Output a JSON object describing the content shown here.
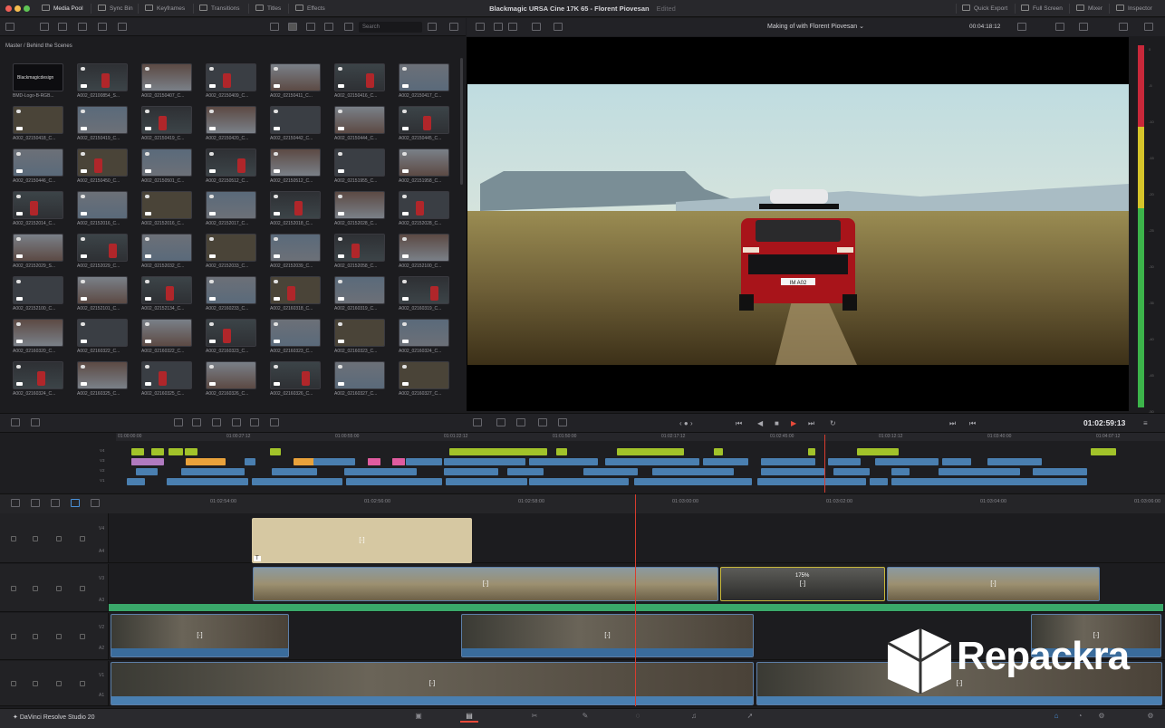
{
  "topbar": {
    "tabs": [
      "Media Pool",
      "Sync Bin",
      "Keyframes",
      "Transitions",
      "Titles",
      "Effects"
    ],
    "title": "Blackmagic URSA Cine 17K 65 - Florent Piovesan",
    "edited": "Edited",
    "right": [
      "Quick Export",
      "Full Screen",
      "Mixer",
      "Inspector"
    ]
  },
  "mediapool": {
    "search_placeholder": "Search",
    "bin_path": "Master / Behind the Scenes",
    "logo_caption": "Blackmagicdesign",
    "clips": [
      "BMD-Logo-B-RGB...",
      "A002_02100854_S...",
      "A002_02150407_C...",
      "A002_02150409_C...",
      "A002_02150411_C...",
      "A002_02150416_C...",
      "A002_02150417_C...",
      "A002_02150418_C...",
      "A002_02150419_C...",
      "A002_02150419_C...",
      "A002_02150420_C...",
      "A002_02150442_C...",
      "A002_02150444_C...",
      "A002_02150445_C...",
      "A002_02150446_C...",
      "A002_02150450_C...",
      "A002_02150501_C...",
      "A002_02150512_C...",
      "A002_02150512_C...",
      "A002_02151955_C...",
      "A002_02151958_C...",
      "A002_02152014_C...",
      "A002_02152016_C...",
      "A002_02152016_C...",
      "A002_02152017_C...",
      "A002_02152018_C...",
      "A002_02152028_C...",
      "A002_02152028_C...",
      "A002_02152029_S...",
      "A002_02152029_C...",
      "A002_02152032_C...",
      "A002_02152033_C...",
      "A002_02152039_C...",
      "A002_02152058_C...",
      "A002_02152100_C...",
      "A002_02152100_C...",
      "A002_02152101_C...",
      "A002_02152134_C...",
      "A002_02160233_C...",
      "A002_02160318_C...",
      "A002_02160319_C...",
      "A002_02160319_C...",
      "A002_02160320_C...",
      "A002_02160322_C...",
      "A002_02160322_C...",
      "A002_02160323_C...",
      "A002_02160323_C...",
      "A002_02160323_C...",
      "A002_02160324_C...",
      "A002_02160324_C...",
      "A002_02160325_C...",
      "A002_02160325_C...",
      "A002_02160326_C...",
      "A002_02160326_C...",
      "A002_02160327_C...",
      "A002_02160327_C..."
    ]
  },
  "viewer": {
    "title": "Making of with Florent Piovesan",
    "timecode_top": "00:04:18:12",
    "timecode": "01:02:59:13",
    "plate": "IM A02"
  },
  "meter_labels": [
    "0",
    "-5",
    "-10",
    "-15",
    "-20",
    "-25",
    "-30",
    "-35",
    "-40",
    "-45",
    "-50"
  ],
  "mini_ruler": [
    "01:00:00:00",
    "01:00:27:12",
    "01:00:55:00",
    "01:01:22:12",
    "01:01:50:00",
    "01:02:17:12",
    "01:02:45:00",
    "01:03:12:12",
    "01:03:40:00",
    "01:04:07:12"
  ],
  "main_ruler": [
    "01:02:54:00",
    "01:02:56:00",
    "01:02:58:00",
    "01:03:00:00",
    "01:03:02:00",
    "01:03:04:00",
    "01:03:06:00"
  ],
  "tracks": [
    {
      "v": "V4",
      "a": "A4"
    },
    {
      "v": "V3",
      "a": "A3"
    },
    {
      "v": "V2",
      "a": "A2"
    },
    {
      "v": "V1",
      "a": "A1"
    }
  ],
  "speed_label": "175%",
  "fx_symbol": "[·]",
  "title_badge": "T",
  "brand": "DaVinci Resolve Studio 20",
  "watermark": "Repackra"
}
